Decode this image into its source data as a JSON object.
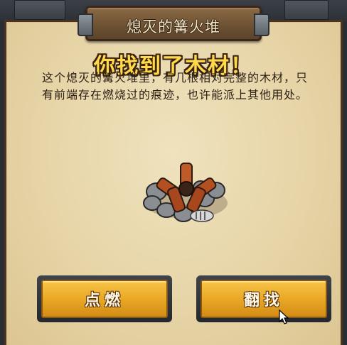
{
  "dialog": {
    "title": "熄灭的篝火堆",
    "headline": "你找到了木材！",
    "description": "这个熄灭的篝火堆里，有几根相对完整的木材，只有前端存在燃烧过的痕迹，也许能派上其他用处。"
  },
  "buttons": {
    "ignite": "点燃",
    "search": "翻找"
  },
  "colors": {
    "headline": "#ffd94a",
    "button": "#eaa825",
    "parchment": "#e7d5a8"
  }
}
